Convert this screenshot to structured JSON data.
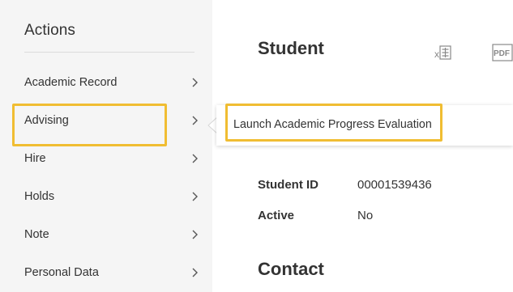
{
  "actions": {
    "title": "Actions",
    "items": [
      {
        "label": "Academic Record"
      },
      {
        "label": "Advising"
      },
      {
        "label": "Hire"
      },
      {
        "label": "Holds"
      },
      {
        "label": "Note"
      },
      {
        "label": "Personal Data"
      }
    ]
  },
  "popup": {
    "item_label": "Launch Academic Progress Evaluation"
  },
  "main": {
    "title": "Student",
    "excel_icon": "excel-export-icon",
    "pdf_icon": "pdf-export-icon",
    "pdf_icon_text": "PDF",
    "fields": [
      {
        "label": "Student ID",
        "value": "00001539436"
      },
      {
        "label": "Active",
        "value": "No"
      }
    ],
    "section_title": "Contact"
  },
  "colors": {
    "highlight": "#f0bd32",
    "panel_bg": "#f5f5f5",
    "text": "#333333",
    "icon_gray": "#888888"
  }
}
